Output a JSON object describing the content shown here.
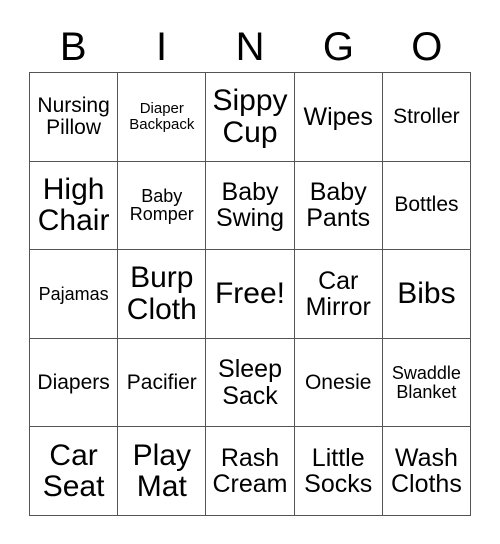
{
  "card": {
    "type": "bingo-card",
    "theme": "baby-shower",
    "columns": 5,
    "rows": 5,
    "colors": {
      "background": "#ffffff",
      "text": "#000000",
      "grid_line": "#555555"
    }
  },
  "header": {
    "letters": [
      "B",
      "I",
      "N",
      "G",
      "O"
    ]
  },
  "grid": {
    "rows": [
      [
        {
          "text": "Nursing\nPillow",
          "size": "md"
        },
        {
          "text": "Diaper\nBackpack",
          "size": "xs"
        },
        {
          "text": "Sippy\nCup",
          "size": "xl"
        },
        {
          "text": "Wipes",
          "size": "lg"
        },
        {
          "text": "Stroller",
          "size": "md"
        }
      ],
      [
        {
          "text": "High\nChair",
          "size": "xl"
        },
        {
          "text": "Baby\nRomper",
          "size": "sm"
        },
        {
          "text": "Baby\nSwing",
          "size": "lg"
        },
        {
          "text": "Baby\nPants",
          "size": "lg"
        },
        {
          "text": "Bottles",
          "size": "md"
        }
      ],
      [
        {
          "text": "Pajamas",
          "size": "sm"
        },
        {
          "text": "Burp\nCloth",
          "size": "xl"
        },
        {
          "text": "Free!",
          "size": "xl"
        },
        {
          "text": "Car\nMirror",
          "size": "lg"
        },
        {
          "text": "Bibs",
          "size": "xl"
        }
      ],
      [
        {
          "text": "Diapers",
          "size": "md"
        },
        {
          "text": "Pacifier",
          "size": "md"
        },
        {
          "text": "Sleep\nSack",
          "size": "lg"
        },
        {
          "text": "Onesie",
          "size": "md"
        },
        {
          "text": "Swaddle\nBlanket",
          "size": "sm"
        }
      ],
      [
        {
          "text": "Car\nSeat",
          "size": "xl"
        },
        {
          "text": "Play\nMat",
          "size": "xl"
        },
        {
          "text": "Rash\nCream",
          "size": "lg"
        },
        {
          "text": "Little\nSocks",
          "size": "lg"
        },
        {
          "text": "Wash\nCloths",
          "size": "lg"
        }
      ]
    ]
  }
}
